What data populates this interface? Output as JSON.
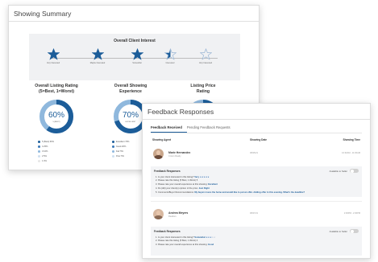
{
  "summary": {
    "title": "Showing Summary",
    "interest": {
      "title": "Overall Client Interest",
      "steps": [
        {
          "label": "Very Interested",
          "filled": true
        },
        {
          "label": "Maybe Interested",
          "filled": true
        },
        {
          "label": "Somewhat",
          "filled": true
        },
        {
          "label": "Interested",
          "filled": "half"
        },
        {
          "label": "Very Interested",
          "filled": false
        }
      ]
    },
    "metrics": [
      {
        "title_line1": "Overall Listing Rating",
        "title_line2": "(5=Best, 1=Worst)",
        "percent": "60%",
        "sub": "5 (BEST)",
        "fraction": 0.6,
        "legend": [
          "5 (Best) 60%",
          "4 25%",
          "3 10%",
          "2 5%",
          "1 0%"
        ]
      },
      {
        "title_line1": "Overall Showing",
        "title_line2": "Experience",
        "percent": "70%",
        "sub": "EXCELLENT",
        "fraction": 0.7,
        "legend": [
          "Excellent 70%",
          "Good 20%",
          "Fair 5%",
          "Poor 5%"
        ]
      },
      {
        "title_line1": "Listing Price",
        "title_line2": "Rating",
        "percent": "",
        "sub": "",
        "fraction": 0.5,
        "legend": []
      }
    ],
    "colors": {
      "primary": "#1c5d99",
      "light": "#8fb8dd",
      "pale": "#cfe0f0"
    }
  },
  "feedback": {
    "title": "Feedback Responses",
    "tabs": [
      "Feedback Received",
      "Pending Feedback Requests"
    ],
    "columns": {
      "agent": "Showing Agent",
      "date": "Showing Date",
      "time": "Showing Time"
    },
    "entries": [
      {
        "name": "Marie Hernandez",
        "company": "Crown Realty",
        "date": "08/25/21",
        "time": "10:30AM - 11:00AM",
        "section_title": "Feedback Responses",
        "visible_label": "Available to Seller",
        "lines": [
          {
            "text": "1. Is your client interested in this listing?",
            "answer": "Very",
            "stars": 5
          },
          {
            "text": "2. Please rate this listing (5 Best, 1 Worst) 5",
            "answer": "",
            "stars": 0
          },
          {
            "text": "3. Please rate your overall experience at this showing:",
            "answer": "Excellent",
            "stars": 0
          },
          {
            "text": "4. Do (did) your client(s) opinion of the price:",
            "answer": "Just Right",
            "stars": 0
          },
          {
            "text": "5. Comments/Buyer Recommendations:",
            "answer": "My buyers loves the home and would like to put an offer. Adding offer in this evening. What's the deadline?",
            "stars": 0
          }
        ]
      },
      {
        "name": "Andrea Meyers",
        "company": "Realtors",
        "date": "08/27/21",
        "time": "2:00PM - 2:30PM",
        "section_title": "Feedback Responses",
        "visible_label": "Available to Seller",
        "lines": [
          {
            "text": "1. Is your client interested in this listing?",
            "answer": "Somewhat",
            "stars": 3
          },
          {
            "text": "2. Please rate this listing (5 Best, 1 Worst) 4",
            "answer": "",
            "stars": 0
          },
          {
            "text": "3. Please rate your overall experience at this showing:",
            "answer": "Good",
            "stars": 0
          }
        ]
      }
    ]
  }
}
